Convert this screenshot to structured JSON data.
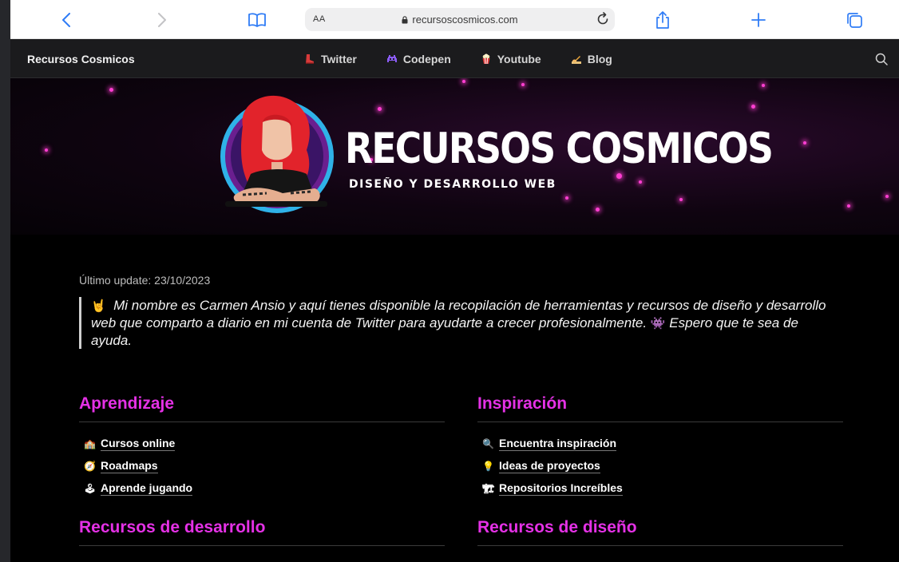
{
  "browser": {
    "aa_label": "AA",
    "url": "recursoscosmicos.com"
  },
  "nav": {
    "brand": "Recursos Cosmicos",
    "links": [
      {
        "label": "Twitter",
        "icon": "boot-icon"
      },
      {
        "label": "Codepen",
        "icon": "space-invader-icon"
      },
      {
        "label": "Youtube",
        "icon": "popcorn-icon"
      },
      {
        "label": "Blog",
        "icon": "writing-hand-icon"
      }
    ]
  },
  "banner": {
    "title": "RECURSOS COSMICOS",
    "subtitle": "DISEÑO Y DESARROLLO WEB"
  },
  "main": {
    "update": "Último update: 23/10/2023",
    "intro": {
      "emoji_start": "🤘",
      "text_1": "Mi nombre es Carmen Ansio y aquí tienes disponible la recopilación de herramientas y recursos de diseño y desarrollo web que comparto a diario en mi cuenta de Twitter para ayudarte a crecer profesionalmente.",
      "emoji_mid": "👾",
      "text_2": "Espero que te sea de ayuda."
    },
    "sections": [
      {
        "title": "Aprendizaje",
        "items": [
          {
            "icon": "🏫",
            "label": "Cursos online"
          },
          {
            "icon": "🧭",
            "label": "Roadmaps"
          },
          {
            "icon": "🕹",
            "label": "Aprende jugando"
          }
        ]
      },
      {
        "title": "Inspiración",
        "items": [
          {
            "icon": "🔍",
            "label": "Encuentra inspiración"
          },
          {
            "icon": "💡",
            "label": "Ideas de proyectos"
          },
          {
            "icon": "🏗",
            "label": "Repositorios Increíbles"
          }
        ]
      },
      {
        "title": "Recursos de desarrollo",
        "items": []
      },
      {
        "title": "Recursos de diseño",
        "items": []
      }
    ]
  },
  "colors": {
    "accent": "#e531e6",
    "page_bg": "#000000",
    "nav_bg": "#1b1b1d",
    "safari_icon": "#2f7cf6"
  }
}
